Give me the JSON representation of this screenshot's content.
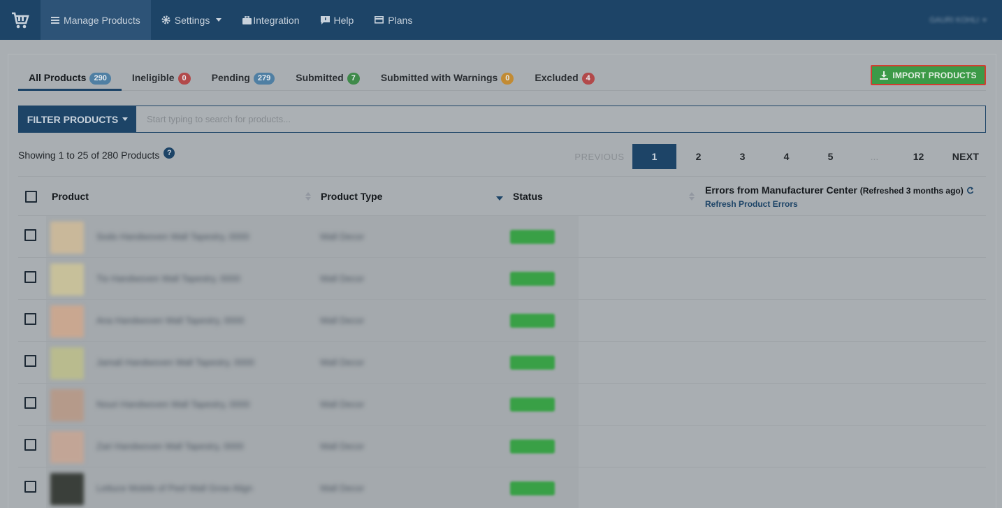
{
  "nav": {
    "logo_icon": "shopping-cart-icon",
    "items": [
      {
        "label": "Manage Products",
        "icon": "list-icon",
        "active": true
      },
      {
        "label": "Settings",
        "icon": "gear-icon",
        "dropdown": true
      },
      {
        "label": "Integration",
        "icon": "briefcase-icon"
      },
      {
        "label": "Help",
        "icon": "chat-icon"
      },
      {
        "label": "Plans",
        "icon": "card-icon"
      }
    ],
    "user_name": "GAURI KOHLI"
  },
  "tabs": [
    {
      "label": "All Products",
      "count": "290",
      "color": "blue",
      "active": true
    },
    {
      "label": "Ineligible",
      "count": "0",
      "color": "red"
    },
    {
      "label": "Pending",
      "count": "279",
      "color": "blue"
    },
    {
      "label": "Submitted",
      "count": "7",
      "color": "green"
    },
    {
      "label": "Submitted with Warnings",
      "count": "0",
      "color": "orange"
    },
    {
      "label": "Excluded",
      "count": "4",
      "color": "red"
    }
  ],
  "import_button": "IMPORT PRODUCTS",
  "filter": {
    "button_label": "FILTER PRODUCTS",
    "search_placeholder": "Start typing to search for products..."
  },
  "showing_text": "Showing 1 to 25 of 280 Products",
  "pagination": {
    "previous": "PREVIOUS",
    "pages": [
      "1",
      "2",
      "3",
      "4",
      "5",
      "...",
      "12"
    ],
    "current": "1",
    "next": "NEXT"
  },
  "table": {
    "headers": {
      "product": "Product",
      "product_type": "Product Type",
      "status": "Status",
      "errors": "Errors from Manufacturer Center",
      "errors_note": "(Refreshed 3 months ago)",
      "refresh_link": "Refresh Product Errors"
    },
    "rows": [
      {
        "name": "Sodo Handwoven Wall Tapestry, 0000",
        "type": "Wall Decor",
        "thumb_color": "#c9b89a"
      },
      {
        "name": "Tio Handwoven Wall Tapestry, 0000",
        "type": "Wall Decor",
        "thumb_color": "#c7c09a"
      },
      {
        "name": "Ana Handwoven Wall Tapestry, 0000",
        "type": "Wall Decor",
        "thumb_color": "#c9a790"
      },
      {
        "name": "Jamali Handwoven Wall Tapestry, 0000",
        "type": "Wall Decor",
        "thumb_color": "#b9bb8e"
      },
      {
        "name": "Nouri Handwoven Wall Tapestry, 0000",
        "type": "Wall Decor",
        "thumb_color": "#b59a8a"
      },
      {
        "name": "Zari Handwoven Wall Tapestry, 0000",
        "type": "Wall Decor",
        "thumb_color": "#c2a596"
      },
      {
        "name": "Lettuce Mobile of Peel Wall Grow Align",
        "type": "Wall Decor",
        "thumb_color": "#3a3f3a"
      }
    ]
  }
}
